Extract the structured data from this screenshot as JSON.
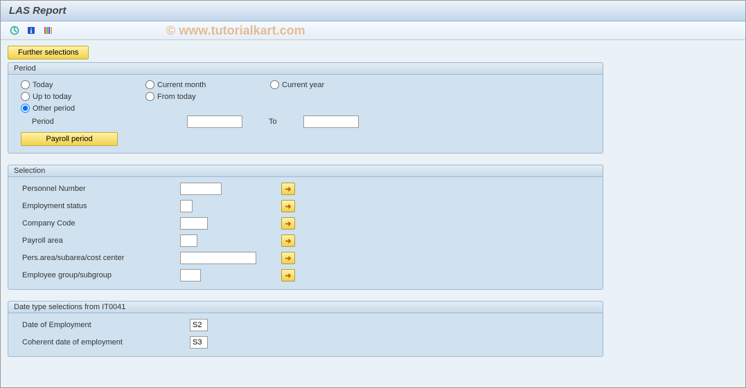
{
  "title": "LAS Report",
  "watermark": "© www.tutorialkart.com",
  "buttons": {
    "further_selections": "Further selections",
    "payroll_period": "Payroll period"
  },
  "groups": {
    "period": {
      "title": "Period",
      "radios": {
        "today": "Today",
        "current_month": "Current month",
        "current_year": "Current year",
        "up_to_today": "Up to today",
        "from_today": "From today",
        "other_period": "Other period"
      },
      "period_label": "Period",
      "to_label": "To",
      "period_from": "",
      "period_to": ""
    },
    "selection": {
      "title": "Selection",
      "fields": [
        {
          "label": "Personnel Number",
          "value": "",
          "width": 60
        },
        {
          "label": "Employment status",
          "value": "",
          "width": 18
        },
        {
          "label": "Company Code",
          "value": "",
          "width": 40
        },
        {
          "label": "Payroll area",
          "value": "",
          "width": 25
        },
        {
          "label": "Pers.area/subarea/cost center",
          "value": "",
          "width": 110
        },
        {
          "label": "Employee group/subgroup",
          "value": "",
          "width": 30
        }
      ]
    },
    "datetype": {
      "title": "Date type selections from IT0041",
      "fields": [
        {
          "label": "Date of Employment",
          "value": "S2"
        },
        {
          "label": "Coherent date of employment",
          "value": "S3"
        }
      ]
    }
  }
}
